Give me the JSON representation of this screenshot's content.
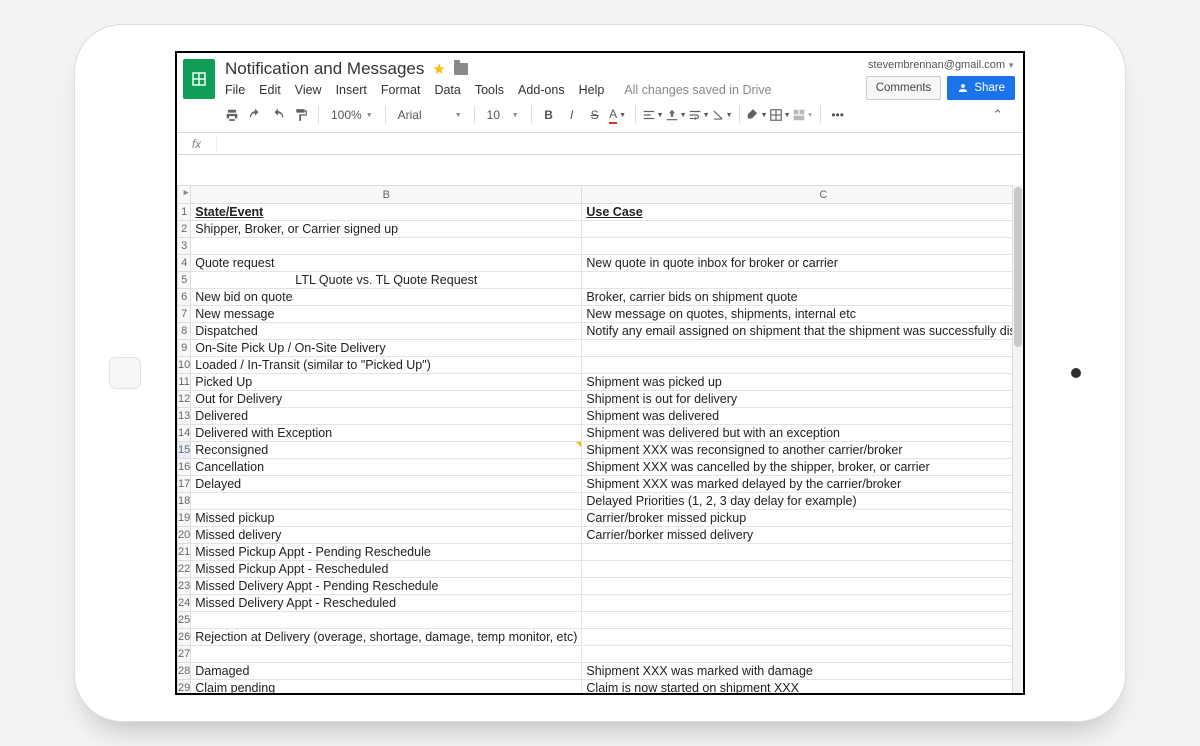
{
  "account_email": "stevembrennan@gmail.com",
  "doc_title": "Notification and Messages",
  "menus": [
    "File",
    "Edit",
    "View",
    "Insert",
    "Format",
    "Data",
    "Tools",
    "Add-ons",
    "Help"
  ],
  "save_msg": "All changes saved in Drive",
  "comments_label": "Comments",
  "share_label": "Share",
  "toolbar": {
    "zoom": "100%",
    "font": "Arial",
    "size": "10"
  },
  "fx_label": "fx",
  "columns": {
    "B": "B",
    "C": "C"
  },
  "header_row": {
    "b": "State/Event",
    "c": "Use Case"
  },
  "rows": [
    {
      "n": 1,
      "b": "State/Event",
      "c": "Use Case",
      "hdr": true
    },
    {
      "n": 2,
      "b": "Shipper, Broker, or Carrier signed up",
      "c": ""
    },
    {
      "n": 3,
      "b": "",
      "c": ""
    },
    {
      "n": 4,
      "b": "Quote request",
      "c": "New quote in quote inbox for broker or carrier"
    },
    {
      "n": 5,
      "b": "LTL Quote vs. TL Quote Request",
      "c": "",
      "center": true
    },
    {
      "n": 6,
      "b": "New bid on quote",
      "c": "Broker, carrier bids on shipment quote"
    },
    {
      "n": 7,
      "b": "New message",
      "c": "New message on quotes, shipments, internal etc"
    },
    {
      "n": 8,
      "b": "Dispatched",
      "c": "Notify any email assigned on shipment that the shipment was successfully dispatched"
    },
    {
      "n": 9,
      "b": "On-Site Pick Up / On-Site Delivery",
      "c": ""
    },
    {
      "n": 10,
      "b": "Loaded / In-Transit (similar to \"Picked Up\")",
      "c": ""
    },
    {
      "n": 11,
      "b": "Picked Up",
      "c": "Shipment was picked up"
    },
    {
      "n": 12,
      "b": "Out for Delivery",
      "c": "Shipment is out for delivery"
    },
    {
      "n": 13,
      "b": "Delivered",
      "c": "Shipment was delivered"
    },
    {
      "n": 14,
      "b": "Delivered with Exception",
      "c": "Shipment was delivered but with an exception"
    },
    {
      "n": 15,
      "b": "Reconsigned",
      "c": "Shipment XXX was reconsigned to another carrier/broker",
      "sel": true,
      "note": true
    },
    {
      "n": 16,
      "b": "Cancellation",
      "c": "Shipment XXX was cancelled by the shipper, broker, or carrier"
    },
    {
      "n": 17,
      "b": "Delayed",
      "c": "Shipment XXX was marked delayed by the carrier/broker"
    },
    {
      "n": 18,
      "b": "",
      "c": "Delayed Priorities (1, 2, 3 day delay for example)"
    },
    {
      "n": 19,
      "b": "Missed pickup",
      "c": "Carrier/broker missed pickup"
    },
    {
      "n": 20,
      "b": "Missed delivery",
      "c": "Carrier/borker missed delivery"
    },
    {
      "n": 21,
      "b": "Missed Pickup Appt - Pending Reschedule",
      "c": ""
    },
    {
      "n": 22,
      "b": "Missed Pickup Appt - Rescheduled",
      "c": ""
    },
    {
      "n": 23,
      "b": "Missed Delivery Appt - Pending Reschedule",
      "c": ""
    },
    {
      "n": 24,
      "b": "Missed Delivery Appt - Rescheduled",
      "c": ""
    },
    {
      "n": 25,
      "b": "",
      "c": ""
    },
    {
      "n": 26,
      "b": "Rejection at Delivery (overage, shortage, damage, temp monitor, etc)",
      "c": ""
    },
    {
      "n": 27,
      "b": "",
      "c": ""
    },
    {
      "n": 28,
      "b": "Damaged",
      "c": "Shipment XXX was marked with damage"
    },
    {
      "n": 29,
      "b": "Claim pending",
      "c": "Claim is now started on shipment XXX"
    }
  ]
}
